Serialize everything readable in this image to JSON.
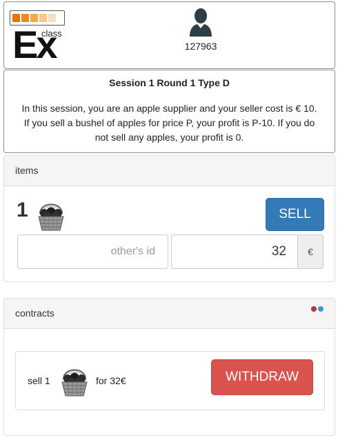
{
  "header": {
    "logo": {
      "text_main": "Ex",
      "text_small": "class",
      "bar_colors": [
        "#e8720c",
        "#f08a1c",
        "#f5a84a",
        "#f6c98a",
        "#f6dfbf"
      ]
    },
    "user": {
      "icon": "user-icon",
      "id": "127963"
    }
  },
  "info": {
    "title": "Session 1 Round 1 Type D",
    "lines": [
      "In this session, you are an apple supplier and your seller cost is € 10.",
      "If you sell a bushel of apples for price P, your profit is P-10. If you do",
      "not sell any apples, your profit is 0."
    ]
  },
  "items": {
    "heading": "items",
    "quantity": "1",
    "item_icon": "apple-basket-icon",
    "sell_label": "SELL",
    "other_id_placeholder": "other's id",
    "price_value": "32",
    "currency": "€"
  },
  "contracts": {
    "heading": "contracts",
    "status_dot_colors": [
      "#b33a3a",
      "#3f9bd1"
    ],
    "entries": [
      {
        "prefix": "sell 1",
        "item_icon": "apple-basket-icon",
        "suffix": "for 32€",
        "action_label": "WITHDRAW"
      }
    ]
  },
  "colors": {
    "primary": "#337ab7",
    "danger": "#d9534f",
    "panel_heading": "#f5f5f5"
  }
}
